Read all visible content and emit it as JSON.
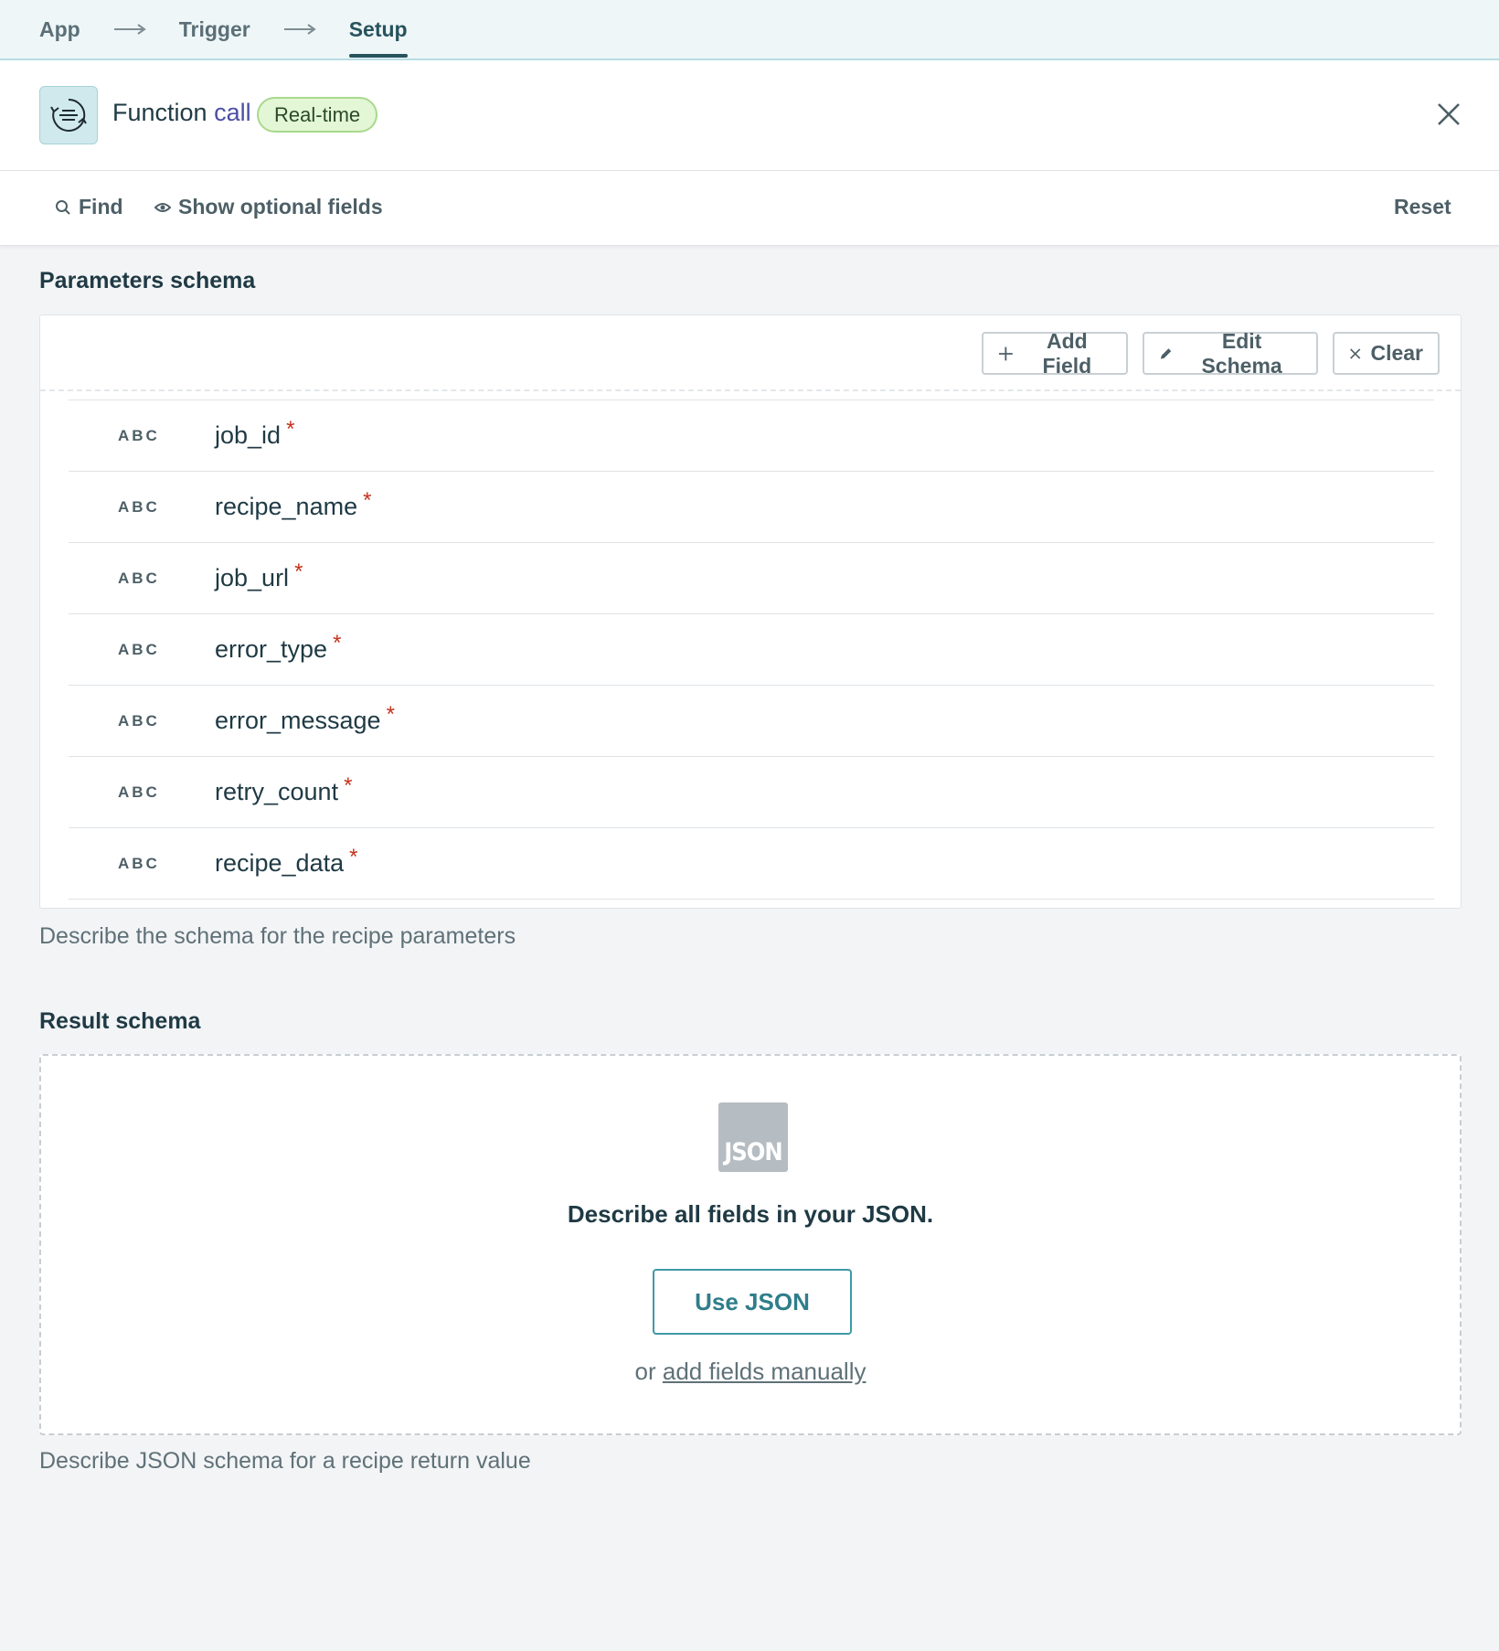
{
  "breadcrumb": {
    "items": [
      "App",
      "Trigger",
      "Setup"
    ],
    "active_index": 2
  },
  "header": {
    "title_main": "Function",
    "title_accent": "call",
    "badge": "Real-time"
  },
  "toolbar": {
    "find_label": "Find",
    "optional_label": "Show optional fields",
    "reset_label": "Reset"
  },
  "parameters": {
    "title": "Parameters schema",
    "buttons": {
      "add": "Add Field",
      "edit": "Edit Schema",
      "clear": "Clear"
    },
    "fields": [
      {
        "type": "ABC",
        "name": "job_id",
        "required_mark": "*"
      },
      {
        "type": "ABC",
        "name": "recipe_name",
        "required_mark": "*"
      },
      {
        "type": "ABC",
        "name": "job_url",
        "required_mark": "*"
      },
      {
        "type": "ABC",
        "name": "error_type",
        "required_mark": "*"
      },
      {
        "type": "ABC",
        "name": "error_message",
        "required_mark": "*"
      },
      {
        "type": "ABC",
        "name": "retry_count",
        "required_mark": "*"
      },
      {
        "type": "ABC",
        "name": "recipe_data",
        "required_mark": "*"
      }
    ],
    "hint": "Describe the schema for the recipe parameters"
  },
  "result": {
    "title": "Result schema",
    "icon_text": "JSON",
    "heading": "Describe all fields in your JSON.",
    "use_json_label": "Use JSON",
    "or_text": "or",
    "manual_link": "add fields manually",
    "hint": "Describe JSON schema for a recipe return value"
  },
  "colors": {
    "accent": "#2f7e8a",
    "badge_bg": "#e3f6d5",
    "required": "#c4321c"
  }
}
